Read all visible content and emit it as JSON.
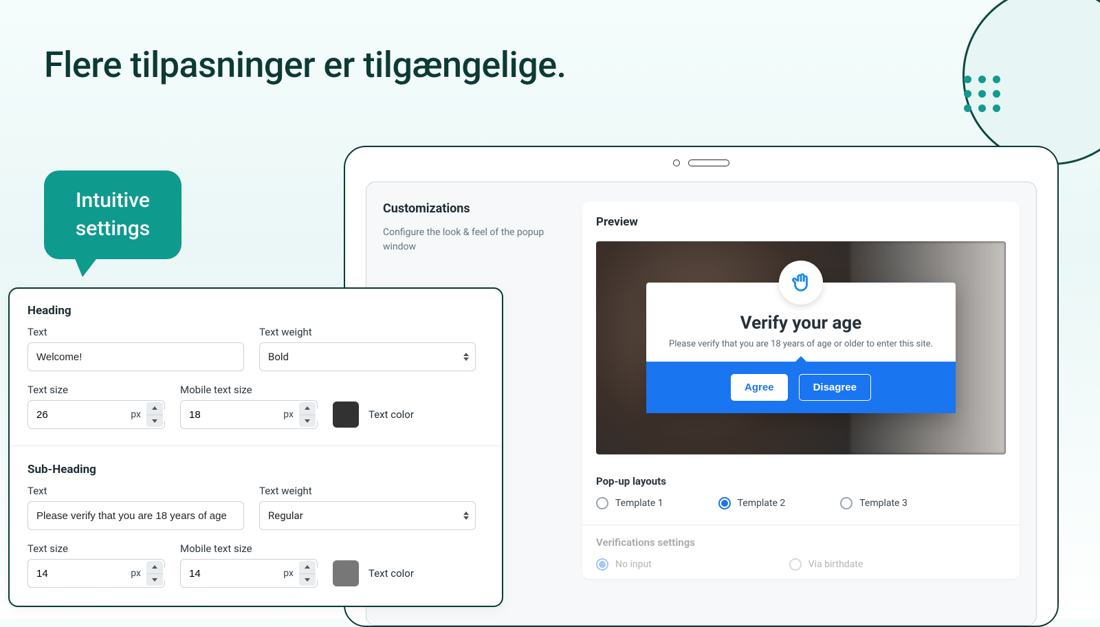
{
  "page_title": "Flere tilpasninger er tilgængelige.",
  "bubble": {
    "line1": "Intuitive",
    "line2": "settings"
  },
  "tablet": {
    "customizations": {
      "title": "Customizations",
      "subtitle": "Configure the look & feel of the popup window"
    },
    "preview": {
      "title": "Preview",
      "popup": {
        "heading": "Verify your age",
        "subheading": "Please verify that you are 18 years of age or older to enter this site.",
        "agree": "Agree",
        "disagree": "Disagree"
      },
      "layouts_label": "Pop-up layouts",
      "layouts": [
        "Template 1",
        "Template 2",
        "Template 3"
      ],
      "layouts_selected": 1,
      "verif_label": "Verifications settings",
      "verif_options": [
        "No input",
        "Via birthdate"
      ],
      "verif_selected": 0
    }
  },
  "settings": {
    "heading": {
      "title": "Heading",
      "text_label": "Text",
      "text_value": "Welcome!",
      "weight_label": "Text weight",
      "weight_value": "Bold",
      "size_label": "Text size",
      "size_value": "26",
      "msize_label": "Mobile text size",
      "msize_value": "18",
      "unit": "px",
      "color_label": "Text color",
      "color_value": "#323232"
    },
    "sub": {
      "title": "Sub-Heading",
      "text_label": "Text",
      "text_value": "Please verify that you are 18 years of age",
      "weight_label": "Text weight",
      "weight_value": "Regular",
      "size_label": "Text size",
      "size_value": "14",
      "msize_label": "Mobile text size",
      "msize_value": "14",
      "unit": "px",
      "color_label": "Text color",
      "color_value": "#777777"
    }
  }
}
